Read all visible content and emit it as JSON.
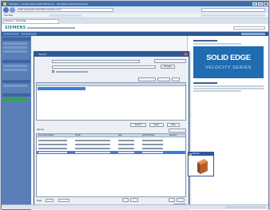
{
  "browser": {
    "title": "Siemens – Customizing PLM Solutions – Windows Internet Explorer",
    "url": "http://www.plm.automation.siemens.com/",
    "favorites_label": "Favorites",
    "tab_label": "Siemens – Solid Edge"
  },
  "site": {
    "logo": "SIEMENS"
  },
  "banner": {
    "title": "SOLID EDGE",
    "subtitle": "VELOCITY SERIES"
  },
  "dialog": {
    "title": "Search",
    "close_label": "x",
    "buttons": {
      "browse": "Browse",
      "search": "Search",
      "clear": "Clear",
      "help": "Help",
      "close": "Close",
      "open": "Open"
    },
    "results_label": "Results",
    "page_label": "Page",
    "results_columns": [
      "Document Name",
      "Folder",
      "Size",
      "Last Modified",
      "Revision"
    ]
  },
  "preview": {
    "title": "Preview"
  },
  "colors": {
    "titlebar": "#3b6db0",
    "sidebar": "#5a7fb8",
    "banner": "#1f6cb0",
    "selection": "#3a7de0",
    "part": "#c0682a"
  },
  "icons": [
    "back-icon",
    "forward-icon",
    "search-icon",
    "home-icon",
    "part-3d-icon",
    "close-icon"
  ]
}
